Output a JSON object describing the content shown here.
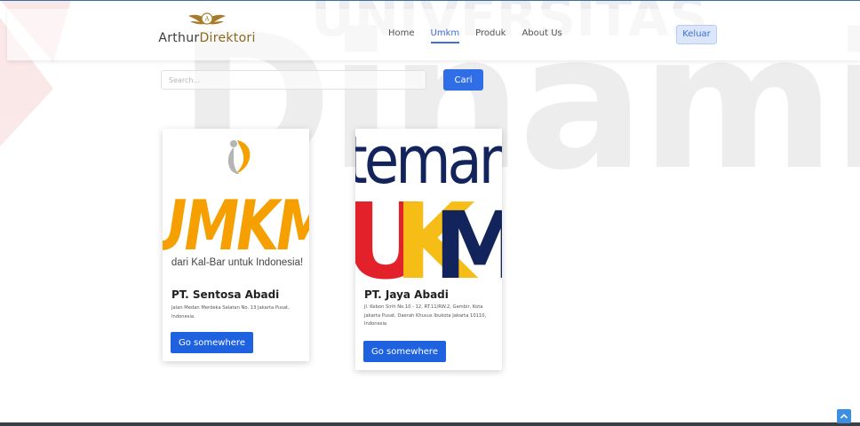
{
  "brand": {
    "name_part1": "Arthur",
    "name_part2": "Direktori"
  },
  "nav": {
    "items": [
      {
        "label": "Home",
        "active": false
      },
      {
        "label": "Umkm",
        "active": true
      },
      {
        "label": "Produk",
        "active": false
      },
      {
        "label": "About Us",
        "active": false
      }
    ],
    "logout_label": "Keluar"
  },
  "search": {
    "placeholder": "Search...",
    "button_label": "Cari"
  },
  "cards": [
    {
      "title": "PT. Sentosa Abadi",
      "address": "Jalan Medan Merdeka Selatan No. 13 Jakarta Pusat, Indonesia.",
      "button_label": "Go somewhere",
      "image": {
        "logo_text": "UMKM",
        "tagline": "dari Kal-Bar untuk Indonesia!"
      }
    },
    {
      "title": "PT. Jaya Abadi",
      "address": "Jl. Kebon Sirih No.10 - 12, RT.11/RW.2, Gambir, Kota Jakarta Pusat, Daerah Khusus Ibukota Jakarta 10110, Indonesia",
      "button_label": "Go somewhere",
      "image": {
        "logo_word1": "teman",
        "logo_letters": [
          "U",
          "K",
          "M"
        ]
      }
    }
  ],
  "watermark": {
    "text": "Dinamik"
  },
  "colors": {
    "primary": "#1f62e0",
    "nav_active": "#3d6fd6",
    "watermark_red": "#d81f26",
    "watermark_grey": "#9a9a9a",
    "umkm_orange": "#f5a000",
    "teman_navy": "#13235b",
    "ukm_red": "#e3212a",
    "ukm_yellow": "#f6bd16"
  },
  "icons": {
    "scroll_top": "chevron-up-icon",
    "brand_logo": "winged-emblem-icon"
  }
}
